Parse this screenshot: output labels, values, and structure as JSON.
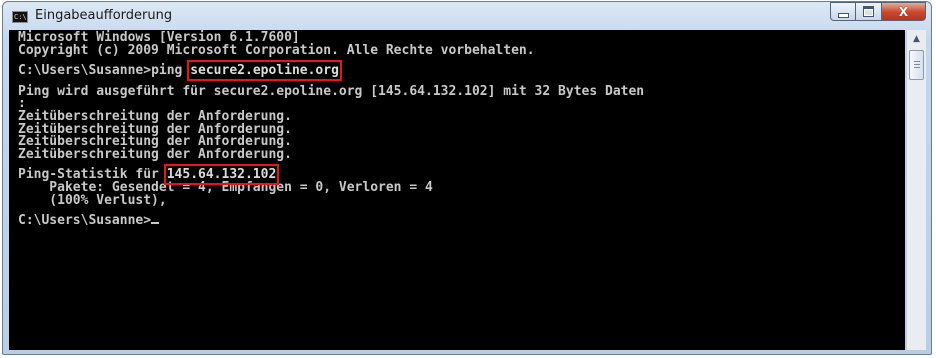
{
  "window": {
    "title": "Eingabeaufforderung",
    "app_icon_text": "C:\\",
    "caption_buttons": {
      "minimize": "–",
      "maximize": "□",
      "close": "X"
    }
  },
  "console": {
    "lines": {
      "l1": "Microsoft Windows [Version 6.1.7600]",
      "l2": "Copyright (c) 2009 Microsoft Corporation. Alle Rechte vorbehalten.",
      "prompt1": "C:\\Users\\Susanne>",
      "cmd": "ping ",
      "host": "secure2.epoline.org",
      "ping_line": "Ping wird ausgeführt für secure2.epoline.org [145.64.132.102] mit 32 Bytes Daten",
      "colon": ":",
      "timeout1": "Zeitüberschreitung der Anforderung.",
      "timeout2": "Zeitüberschreitung der Anforderung.",
      "timeout3": "Zeitüberschreitung der Anforderung.",
      "timeout4": "Zeitüberschreitung der Anforderung.",
      "stats_label": "Ping-Statistik für ",
      "stats_ip": "145.64.132.102",
      "packets": "    Pakete: Gesendet = 4, Empfangen = 0, Verloren = 4",
      "loss": "    (100% Verlust),",
      "prompt2": "C:\\Users\\Susanne>"
    }
  },
  "scrollbar": {
    "up_arrow": "▲"
  }
}
